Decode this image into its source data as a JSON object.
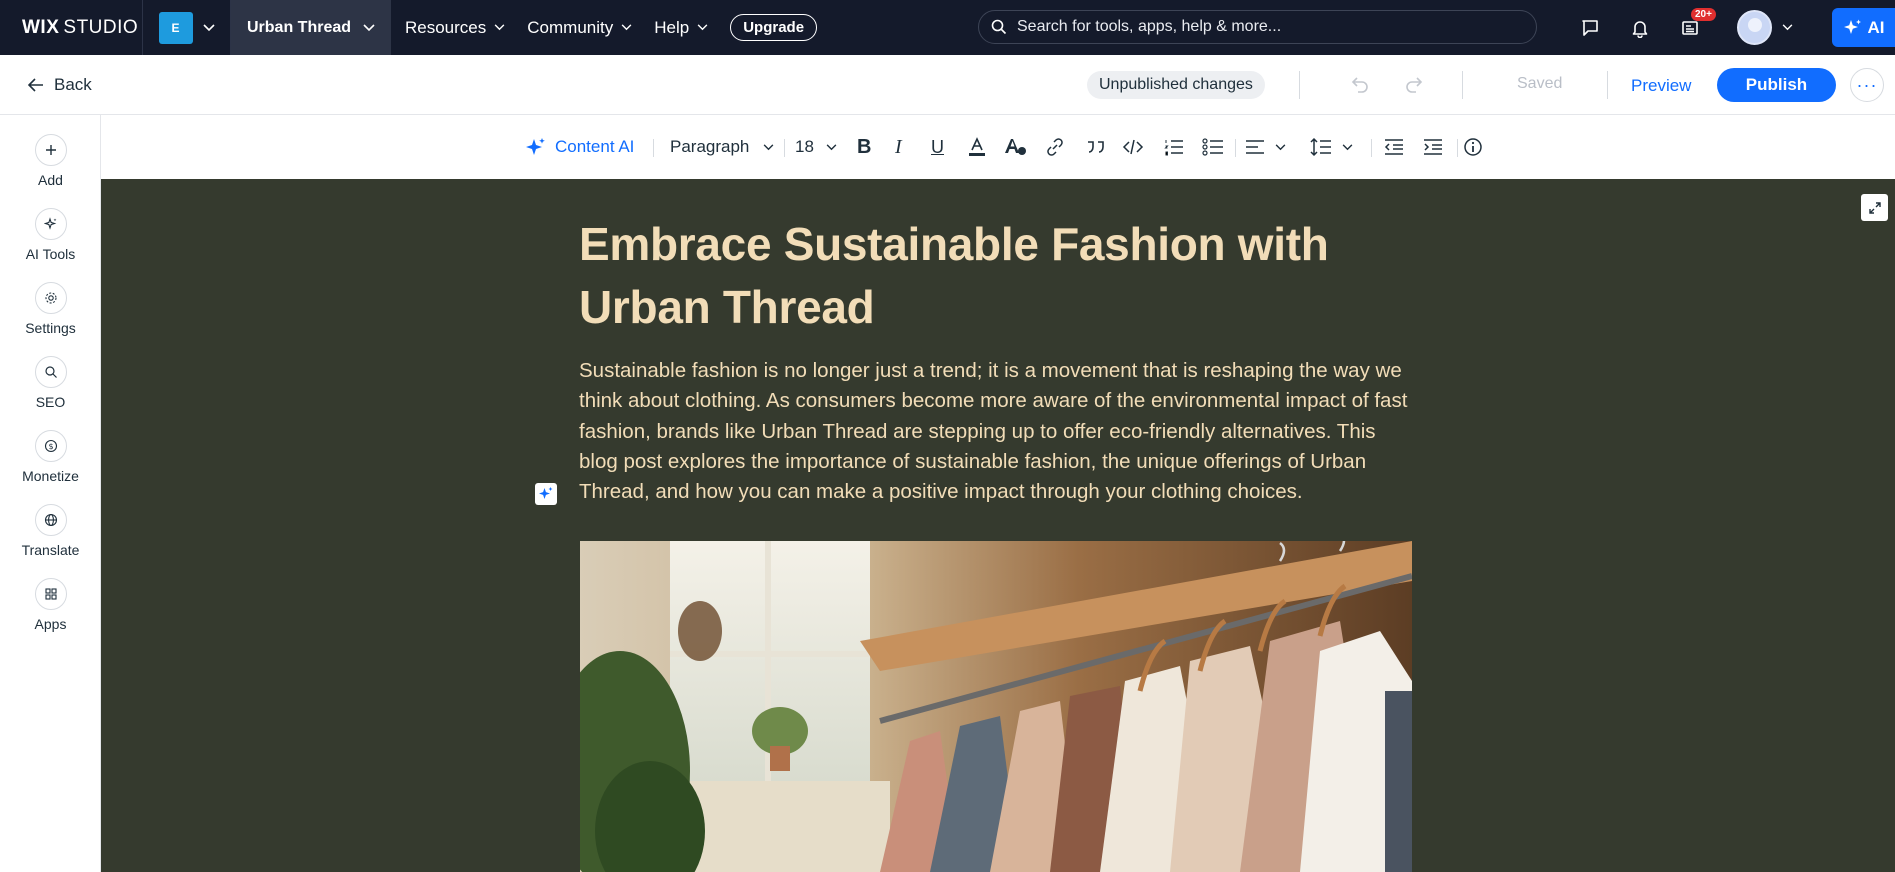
{
  "topbar": {
    "brand_bold": "WIX",
    "brand_rest": "STUDIO",
    "workspace_letter": "E",
    "site_name": "Urban Thread",
    "nav": [
      "Resources",
      "Community",
      "Help"
    ],
    "upgrade_label": "Upgrade",
    "search_placeholder": "Search for tools, apps, help & more...",
    "notifications_badge": "20+",
    "ai_label": "AI"
  },
  "subbar": {
    "back_label": "Back",
    "status": "Unpublished changes",
    "saved_label": "Saved",
    "preview_label": "Preview",
    "publish_label": "Publish"
  },
  "rail": [
    {
      "label": "Add",
      "icon": "plus-icon"
    },
    {
      "label": "AI Tools",
      "icon": "sparkle-icon"
    },
    {
      "label": "Settings",
      "icon": "gear-icon"
    },
    {
      "label": "SEO",
      "icon": "search-icon"
    },
    {
      "label": "Monetize",
      "icon": "dollar-icon"
    },
    {
      "label": "Translate",
      "icon": "globe-icon"
    },
    {
      "label": "Apps",
      "icon": "apps-icon"
    }
  ],
  "editor_toolbar": {
    "content_ai": "Content AI",
    "paragraph_style": "Paragraph",
    "font_size": "18"
  },
  "post": {
    "title": "Embrace Sustainable Fashion with Urban Thread",
    "body": "Sustainable fashion is no longer just a trend; it is a movement that is reshaping the way we think about clothing. As consumers become more aware of the environmental impact of fast fashion, brands like Urban Thread are stepping up to offer eco-friendly alternatives. This blog post explores the importance of sustainable fashion, the unique offerings of Urban Thread, and how you can make a positive impact through your clothing choices."
  },
  "colors": {
    "topbar_bg": "#141a2b",
    "accent": "#116dff",
    "canvas_bg": "#353a2e",
    "post_text": "#f2ddb8"
  }
}
